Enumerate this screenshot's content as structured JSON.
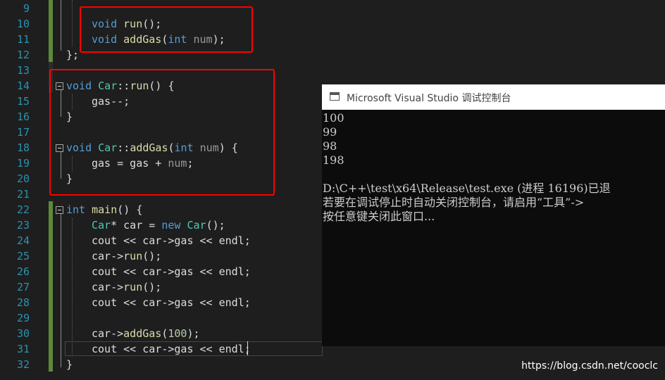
{
  "editor": {
    "line_numbers": [
      "9",
      "10",
      "11",
      "12",
      "13",
      "14",
      "15",
      "16",
      "17",
      "18",
      "19",
      "20",
      "21",
      "22",
      "23",
      "24",
      "25",
      "26",
      "27",
      "28",
      "29",
      "30",
      "31",
      "32"
    ],
    "code": {
      "l10": {
        "kw": "void",
        "fn": "run",
        "rest": "();"
      },
      "l11": {
        "kw": "void",
        "fn": "addGas",
        "open": "(",
        "ptype": "int",
        "param": "num",
        "close": ");"
      },
      "l12": {
        "text": "};"
      },
      "l14": {
        "kw": "void",
        "cls": "Car",
        "sep": "::",
        "fn": "run",
        "rest": "() {"
      },
      "l15": {
        "text": "gas--;"
      },
      "l16": {
        "text": "}"
      },
      "l18": {
        "kw": "void",
        "cls": "Car",
        "sep": "::",
        "fn": "addGas",
        "open": "(",
        "ptype": "int",
        "param": "num",
        "close": ") {"
      },
      "l19": {
        "a": "gas = gas + ",
        "param": "num",
        "b": ";"
      },
      "l20": {
        "text": "}"
      },
      "l22": {
        "kw": "int",
        "fn": "main",
        "rest": "() {"
      },
      "l23": {
        "cls": "Car",
        "a": "* car = ",
        "kw": "new",
        "cls2": "Car",
        "b": "();"
      },
      "l24": {
        "text": "cout << car->gas << endl;"
      },
      "l25": {
        "a": "car->",
        "fn": "run",
        "b": "();"
      },
      "l26": {
        "text": "cout << car->gas << endl;"
      },
      "l27": {
        "a": "car->",
        "fn": "run",
        "b": "();"
      },
      "l28": {
        "text": "cout << car->gas << endl;"
      },
      "l30": {
        "a": "car->",
        "fn": "addGas",
        "b": "(",
        "num": "100",
        "c": ");"
      },
      "l31": {
        "text": "cout << car->gas << endl;"
      },
      "l32": {
        "text": "}"
      }
    }
  },
  "console": {
    "title": "Microsoft Visual Studio 调试控制台",
    "lines": [
      "100",
      "99",
      "98",
      "198",
      "",
      "D:\\C++\\test\\x64\\Release\\test.exe (进程 16196)已退",
      "若要在调试停止时自动关闭控制台，请启用“工具”->",
      "按任意键关闭此窗口..."
    ]
  },
  "watermark": "https://blog.csdn.net/cooclc",
  "colors": {
    "annotation_box": "#ff0000",
    "keyword": "#569cd6",
    "type": "#4ec9b0",
    "function": "#dcdcaa",
    "line_number": "#2b91af"
  }
}
